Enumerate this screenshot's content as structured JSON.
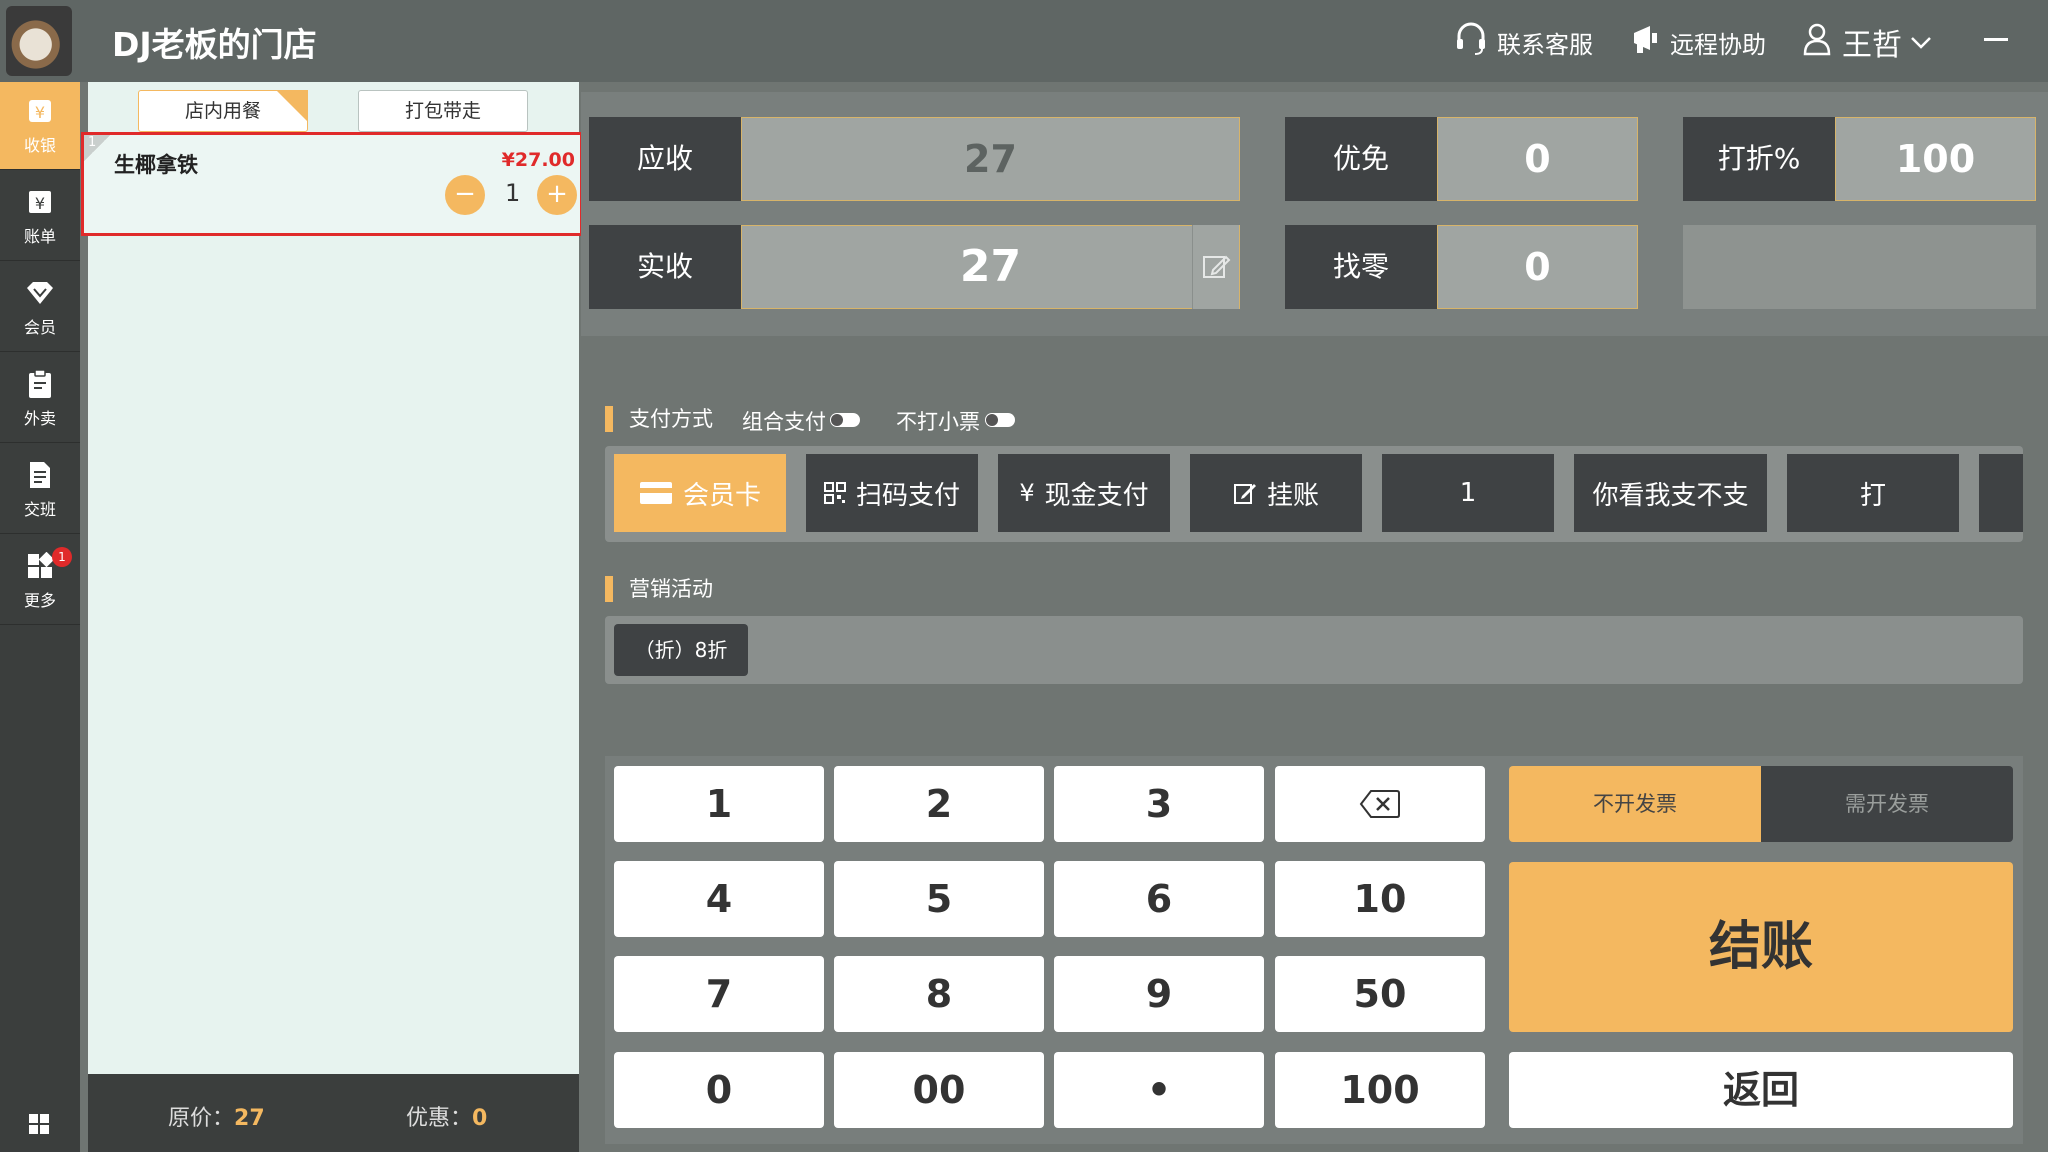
{
  "header": {
    "shop_title": "DJ老板的门店",
    "support_label": "联系客服",
    "remote_label": "远程协助",
    "user_name": "王哲"
  },
  "sidebar": {
    "items": [
      {
        "label": "收银",
        "icon": "cashier-icon",
        "active": true
      },
      {
        "label": "账单",
        "icon": "bill-icon"
      },
      {
        "label": "会员",
        "icon": "diamond-icon"
      },
      {
        "label": "外卖",
        "icon": "clipboard-icon"
      },
      {
        "label": "交班",
        "icon": "document-icon"
      },
      {
        "label": "更多",
        "icon": "apps-icon",
        "badge": "1"
      }
    ]
  },
  "order": {
    "tabs": [
      "店内用餐",
      "打包带走"
    ],
    "item": {
      "index": "1",
      "name": "生椰拿铁",
      "price": "¥27.00",
      "qty": "1",
      "minus": "−",
      "plus": "+"
    },
    "footer": {
      "original_label": "原价：",
      "original_value": "27",
      "discount_label": "优惠：",
      "discount_value": "0"
    }
  },
  "summary": {
    "receivable_label": "应收",
    "receivable_value": "27",
    "waive_label": "优免",
    "waive_value": "0",
    "discount_label": "打折%",
    "discount_value": "100",
    "paid_label": "实收",
    "paid_value": "27",
    "change_label": "找零",
    "change_value": "0"
  },
  "payment": {
    "section_title": "支付方式",
    "combo_label": "组合支付",
    "no_receipt_label": "不打小票",
    "methods": [
      "会员卡",
      "扫码支付",
      "现金支付",
      "挂账",
      "1",
      "你看我支不支",
      "打"
    ]
  },
  "promotion": {
    "section_title": "营销活动",
    "item": "（折）8折"
  },
  "keypad": {
    "keys": [
      "1",
      "2",
      "3",
      "4",
      "5",
      "6",
      "10",
      "7",
      "8",
      "9",
      "50",
      "0",
      "00",
      "•",
      "100"
    ],
    "no_invoice": "不开发票",
    "need_invoice": "需开发票",
    "checkout": "结账",
    "back": "返回"
  },
  "colors": {
    "accent": "#f4b860",
    "dark": "#3f4244",
    "alert": "#e02a2a"
  }
}
